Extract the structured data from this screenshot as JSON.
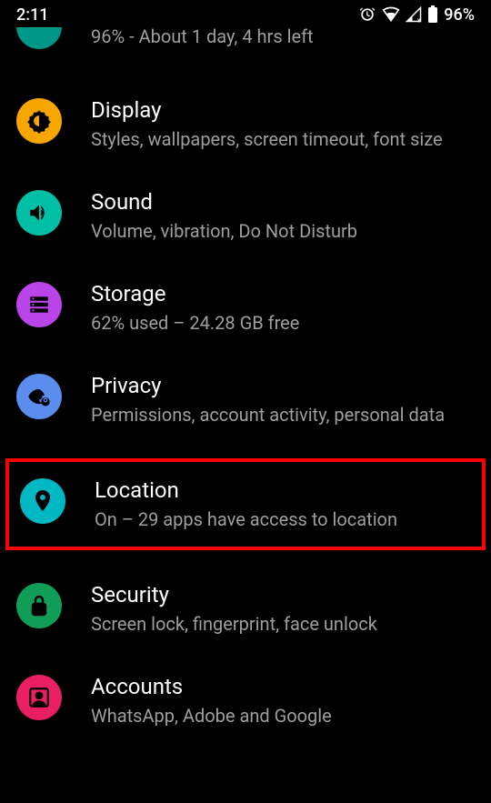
{
  "status": {
    "time": "2:11",
    "battery": "96%"
  },
  "partial": {
    "subtitle": "96% - About 1 day, 4 hrs left"
  },
  "items": {
    "display": {
      "title": "Display",
      "subtitle": "Styles, wallpapers, screen timeout, font size"
    },
    "sound": {
      "title": "Sound",
      "subtitle": "Volume, vibration, Do Not Disturb"
    },
    "storage": {
      "title": "Storage",
      "subtitle": "62% used – 24.28 GB free"
    },
    "privacy": {
      "title": "Privacy",
      "subtitle": "Permissions, account activity, personal data"
    },
    "location": {
      "title": "Location",
      "subtitle": "On – 29 apps have access to location"
    },
    "security": {
      "title": "Security",
      "subtitle": "Screen lock, fingerprint, face unlock"
    },
    "accounts": {
      "title": "Accounts",
      "subtitle": "WhatsApp, Adobe and Google"
    }
  },
  "colors": {
    "display": "#f7a600",
    "sound": "#00bfa5",
    "storage": "#b945e8",
    "privacy": "#5b8def",
    "location": "#00b8c4",
    "security": "#0f9d58",
    "accounts": "#e91e63"
  }
}
